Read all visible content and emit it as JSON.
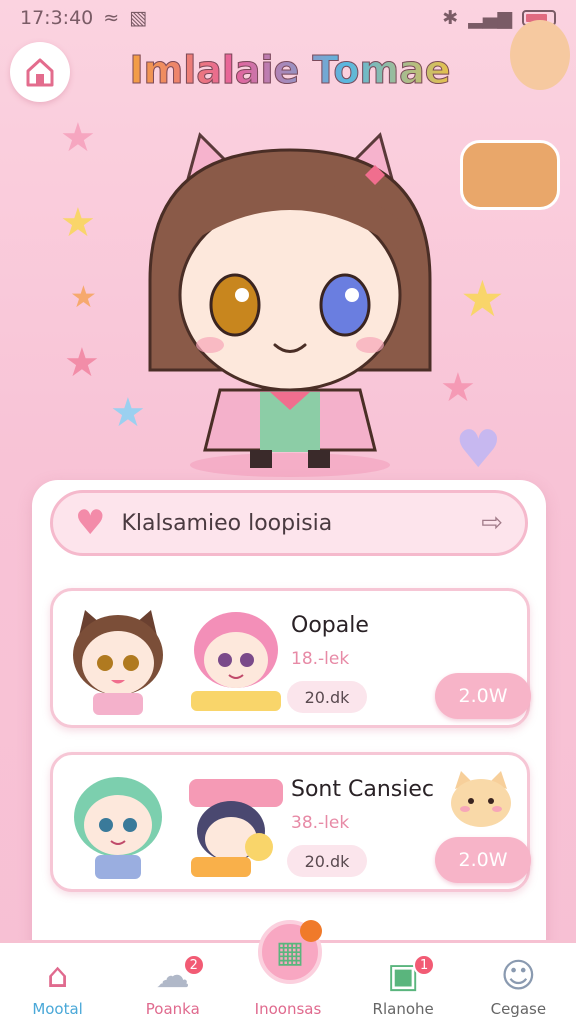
{
  "status_bar": {
    "time": "17:3:40",
    "battery_level": 0.8
  },
  "header": {
    "title": "Imlalaie Tomae",
    "home_icon": "home-icon"
  },
  "search": {
    "text": "Klalsamieo loopisia",
    "icon": "heart-icon",
    "action_icon": "arrow-icon"
  },
  "cards": [
    {
      "title": "Oopale",
      "sub": "18.-lek",
      "pill": "20.dk",
      "button": "2.0W"
    },
    {
      "title": "Sont Cansiec",
      "sub": "38.-lek",
      "pill": "20.dk",
      "button": "2.0W"
    }
  ],
  "tabs": [
    {
      "label": "Mootal",
      "icon": "home-icon",
      "badge": "",
      "color": "#4aa8d8"
    },
    {
      "label": "Poanka",
      "icon": "cloud-icon",
      "badge": "2",
      "color": "#e06a8e"
    },
    {
      "label": "Inoonsas",
      "icon": "map-icon",
      "badge": "",
      "color": "#e06a8e"
    },
    {
      "label": "Rlanohe",
      "icon": "calendar-icon",
      "badge": "1",
      "color": "#666666"
    },
    {
      "label": "Cegase",
      "icon": "user-icon",
      "badge": "",
      "color": "#666666"
    }
  ],
  "colors": {
    "accent": "#f7b4c8",
    "brand": "#e36c8d",
    "badge": "#f25b74"
  }
}
